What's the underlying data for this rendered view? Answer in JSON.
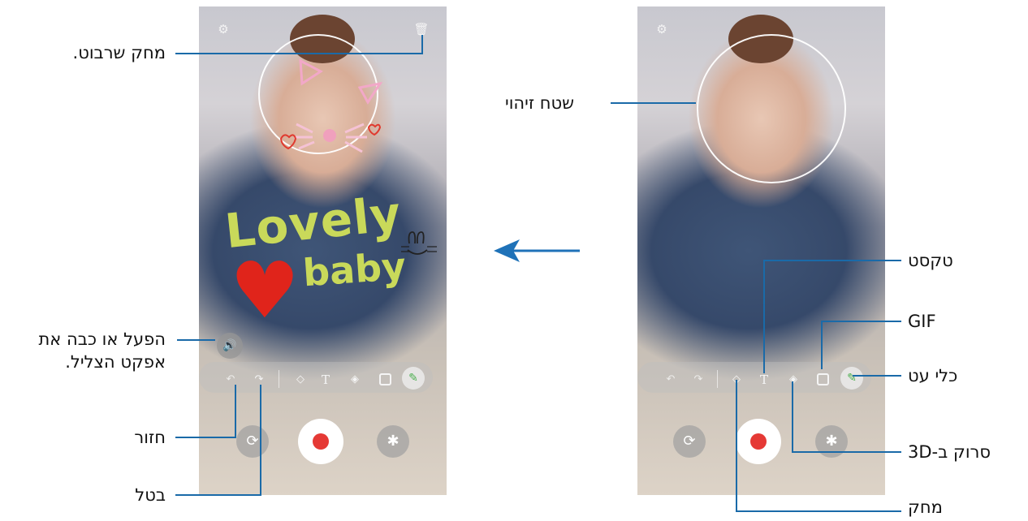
{
  "screen_after": {
    "top_icons": {
      "settings": "settings-icon",
      "delete": "trash-icon"
    },
    "doodle": {
      "word1": "Lovely",
      "word2": "baby"
    },
    "toolbar": [
      "undo-icon",
      "redo-icon",
      "eraser-icon",
      "text-icon",
      "3d-scanner-icon",
      "gif-icon",
      "pen-icon"
    ],
    "controls": [
      "flip-camera-icon",
      "record-button",
      "effects-icon"
    ]
  },
  "screen_before": {
    "top_icons": {
      "settings": "settings-icon"
    },
    "toolbar": [
      "undo-icon",
      "redo-icon",
      "eraser-icon",
      "text-icon",
      "3d-scanner-icon",
      "gif-icon",
      "pen-icon"
    ],
    "controls": [
      "flip-camera-icon",
      "record-button",
      "effects-icon"
    ]
  },
  "callouts_left": {
    "delete_doodle": "מחק שרבוט.",
    "sound_line1": "הפעל או כבה את",
    "sound_line2": "אפקט הצליל.",
    "redo": "חזור",
    "undo": "בטל"
  },
  "callouts_right": {
    "detection_area": "שטח זיהוי",
    "text": "טקסט",
    "gif": "GIF",
    "pen": "כלי עט",
    "scanner": "סרוק ב-3D",
    "eraser": "מחק"
  },
  "colors": {
    "callout_line": "#1a6aa8",
    "arrow": "#1f72b8",
    "doodle_text": "#c9d95a",
    "doodle_heart": "#e0241b",
    "record": "#e53935"
  }
}
